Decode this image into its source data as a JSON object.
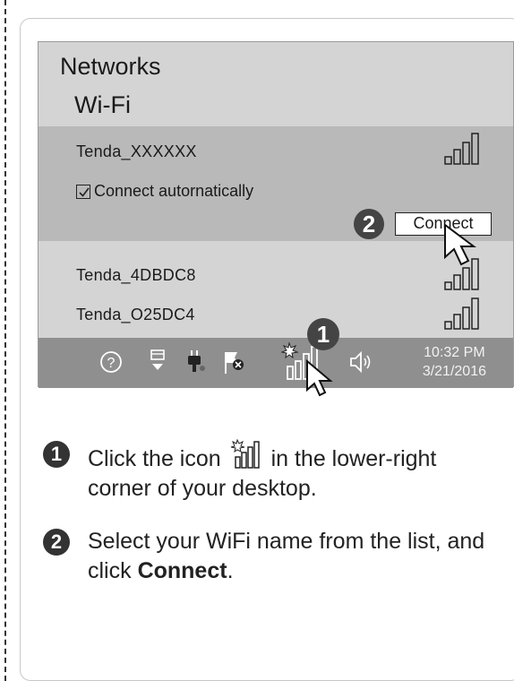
{
  "panel": {
    "title": "Networks",
    "subtitle": "Wi-Fi",
    "networks": [
      {
        "name": "Tenda_XXXXXX"
      },
      {
        "name": "Tenda_4DBDC8"
      },
      {
        "name": "Tenda_O25DC4"
      }
    ],
    "auto_connect_label": "Connect autornatically",
    "auto_connect_checked": true,
    "connect_button": "Connect",
    "callout_numbers": [
      "1",
      "2"
    ]
  },
  "taskbar": {
    "icons": [
      "help-icon",
      "network-icon",
      "power-plug-icon",
      "action-center-flag-icon",
      "wifi-signal-icon",
      "volume-icon"
    ],
    "time": "10:32 PM",
    "date": "3/21/2016"
  },
  "instructions": [
    {
      "number": "1",
      "text_before": "Click the icon",
      "text_after": "in the lower-right corner of your desktop."
    },
    {
      "number": "2",
      "text_before": "Select your WiFi name from the list, and click",
      "bold": "Connect",
      "text_after": "."
    }
  ],
  "colors": {
    "panel_bg": "#d4d4d4",
    "selected_bg": "#b9b9b9",
    "taskbar_bg": "#8f8f8f"
  }
}
